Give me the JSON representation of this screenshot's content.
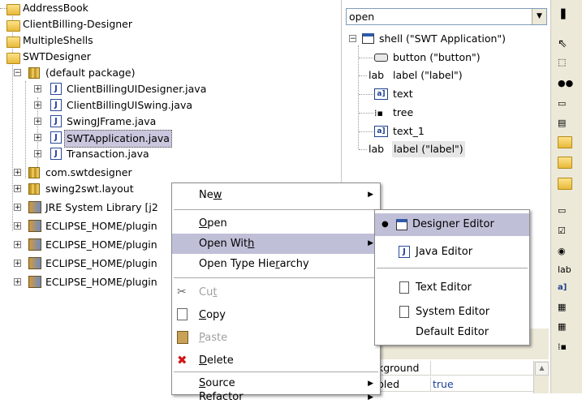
{
  "explorer": {
    "items": [
      {
        "label": "AddressBook",
        "icon": "project-icon"
      },
      {
        "label": "ClientBilling-Designer",
        "icon": "project-icon"
      },
      {
        "label": "MultipleShells",
        "icon": "project-icon"
      },
      {
        "label": "SWTDesigner",
        "icon": "project-icon"
      },
      {
        "label": "(default package)",
        "icon": "package-icon"
      },
      {
        "label": "ClientBillingUIDesigner.java",
        "icon": "java-file-icon"
      },
      {
        "label": "ClientBillingUISwing.java",
        "icon": "java-file-icon"
      },
      {
        "label": "SwingJFrame.java",
        "icon": "java-file-icon"
      },
      {
        "label": "SWTApplication.java",
        "icon": "java-file-icon"
      },
      {
        "label": "Transaction.java",
        "icon": "java-file-icon"
      },
      {
        "label": "com.swtdesigner",
        "icon": "package-icon"
      },
      {
        "label": "swing2swt.layout",
        "icon": "package-icon"
      },
      {
        "label": "JRE System Library [j2",
        "icon": "library-icon"
      },
      {
        "label": "ECLIPSE_HOME/plugin",
        "icon": "library-icon"
      },
      {
        "label": "ECLIPSE_HOME/plugin",
        "icon": "library-icon"
      },
      {
        "label": "ECLIPSE_HOME/plugin",
        "icon": "library-icon"
      },
      {
        "label": "ECLIPSE_HOME/plugin",
        "icon": "library-icon"
      }
    ],
    "selected": "SWTApplication.java"
  },
  "outline": {
    "combo_value": "open",
    "items": [
      {
        "label": "shell (\"SWT Application\")",
        "icon": "shell-icon"
      },
      {
        "label": "button (\"button\")",
        "icon": "button-icon"
      },
      {
        "label": "label (\"label\")",
        "icon": "label-icon"
      },
      {
        "label": "text",
        "icon": "text-icon"
      },
      {
        "label": "tree",
        "icon": "tree-icon"
      },
      {
        "label": "text_1",
        "icon": "text-icon"
      },
      {
        "label": "label (\"label\")",
        "icon": "label-icon"
      }
    ],
    "properties": [
      {
        "name": "kground",
        "value": ""
      },
      {
        "name": "bled",
        "value": "true"
      }
    ]
  },
  "context_menu": {
    "items": [
      {
        "label": "New",
        "mnemonic": "w",
        "submenu": true
      },
      {
        "label": "Open",
        "mnemonic": "O"
      },
      {
        "label": "Open With",
        "mnemonic": "h",
        "submenu": true
      },
      {
        "label": "Open Type Hierarchy",
        "mnemonic": "r"
      },
      {
        "label": "Cut",
        "mnemonic": "t",
        "disabled": true
      },
      {
        "label": "Copy",
        "mnemonic": "C"
      },
      {
        "label": "Paste",
        "mnemonic": "P",
        "disabled": true
      },
      {
        "label": "Delete",
        "mnemonic": "D"
      },
      {
        "label": "Source",
        "mnemonic": "S",
        "submenu": true
      },
      {
        "label": "Refactor",
        "submenu": true
      }
    ]
  },
  "open_with_menu": {
    "items": [
      {
        "label": "Designer Editor",
        "checked": true
      },
      {
        "label": "Java Editor"
      },
      {
        "label": "Text Editor"
      },
      {
        "label": "System Editor"
      },
      {
        "label": "Default Editor"
      }
    ]
  },
  "palette": {
    "items": [
      "selection-arrow-icon",
      "marquee-icon",
      "bean-icon",
      "composite-icon",
      "clipboard-icon",
      "folder-icon",
      "folder-icon",
      "folder-icon",
      "button-icon",
      "checkbox-icon",
      "radio-icon",
      "label-icon",
      "text-icon",
      "table-icon",
      "table-icon",
      "tree-icon"
    ],
    "label_abbrev": "lab"
  }
}
